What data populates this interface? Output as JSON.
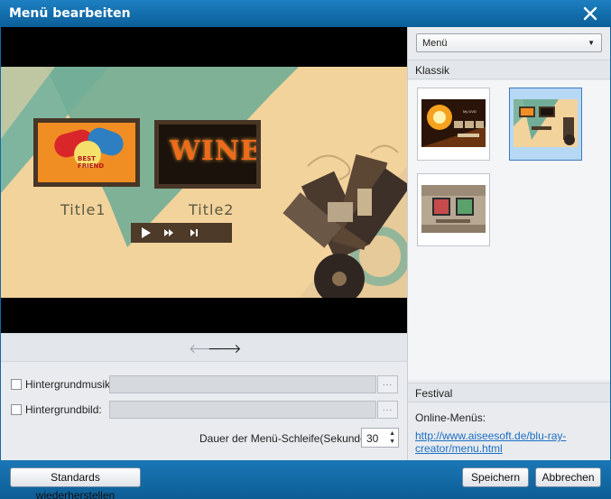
{
  "window": {
    "title": "Menü bearbeiten",
    "close_icon": "close-icon"
  },
  "preview": {
    "title1": "Title1",
    "title2": "Title2",
    "thumb1_text": "BEST FRIEND",
    "thumb2_text": "WINE",
    "controls": [
      "play-icon",
      "fast-forward-icon",
      "skip-next-icon"
    ],
    "nav_prev": "🡐",
    "nav_next": "🡒"
  },
  "settings": {
    "music_label": "Hintergrundmusik:",
    "image_label": "Hintergrundbild:",
    "browse_label": "...",
    "loop_label": "Dauer der Menü-Schleife(Sekunde):",
    "loop_value": "30"
  },
  "right_panel": {
    "dropdown_value": "Menü",
    "section_classic": "Klassik",
    "section_festival": "Festival",
    "online_label": "Online-Menüs:",
    "online_link": "http://www.aiseesoft.de/blu-ray-creator/menu.html",
    "thumb1_caption": "My DVD"
  },
  "footer": {
    "restore_label": "Standards wiederherstellen",
    "save_label": "Speichern",
    "cancel_label": "Abbrechen"
  },
  "colors": {
    "titlebar": "#0b5f99",
    "accent": "#1a6fc4",
    "scene_bg": "#f3d39c",
    "teal": "#6fae9a"
  }
}
